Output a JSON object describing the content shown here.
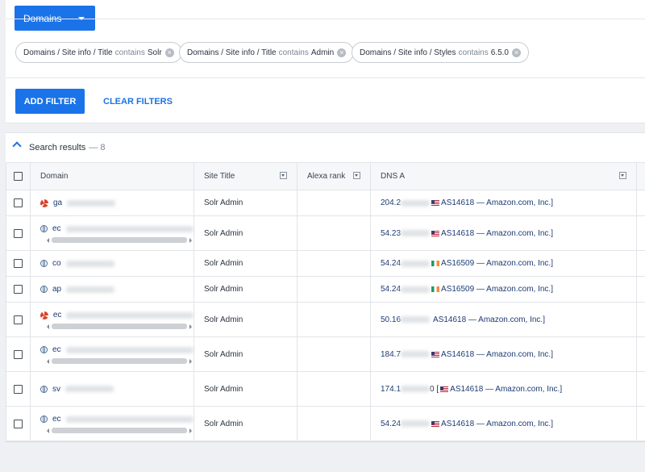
{
  "header": {
    "dropdown_label": "Domains"
  },
  "filters": [
    {
      "path": "Domains / Site info / Title",
      "op": "contains",
      "value": "Solr"
    },
    {
      "path": "Domains / Site info / Title",
      "op": "contains",
      "value": "Admin"
    },
    {
      "path": "Domains / Site info / Styles",
      "op": "contains",
      "value": "6.5.0"
    }
  ],
  "actions": {
    "add_filter": "ADD FILTER",
    "clear_filters": "CLEAR FILTERS"
  },
  "results": {
    "title": "Search results",
    "count": "— 8",
    "columns": [
      "Domain",
      "Site Title",
      "Alexa rank",
      "DNS A"
    ],
    "rows": [
      {
        "domain_prefix": "ga",
        "title": "Solr Admin",
        "alexa": "",
        "ip_prefix": "204.2",
        "asn": "AS14618 — Amazon.com, Inc.]",
        "flag": "us",
        "icon": "favicon-icon",
        "scroll": false
      },
      {
        "domain_prefix": "ec",
        "title": "Solr Admin",
        "alexa": "",
        "ip_prefix": "54.23",
        "asn": "AS14618 — Amazon.com, Inc.]",
        "flag": "us",
        "icon": "globe-icon",
        "scroll": true
      },
      {
        "domain_prefix": "co",
        "title": "Solr Admin",
        "alexa": "",
        "ip_prefix": "54.24",
        "asn": "AS16509 — Amazon.com, Inc.]",
        "flag": "ie",
        "icon": "globe-icon",
        "scroll": false
      },
      {
        "domain_prefix": "ap",
        "title": "Solr Admin",
        "alexa": "",
        "ip_prefix": "54.24",
        "asn": "AS16509 — Amazon.com, Inc.]",
        "flag": "ie",
        "icon": "globe-icon",
        "scroll": false
      },
      {
        "domain_prefix": "ec",
        "title": "Solr Admin",
        "alexa": "",
        "ip_prefix": "50.16",
        "asn": "AS14618 — Amazon.com, Inc.]",
        "flag": "none",
        "icon": "favicon-icon",
        "scroll": true
      },
      {
        "domain_prefix": "ec",
        "title": "Solr Admin",
        "alexa": "",
        "ip_prefix": "184.7",
        "asn": "AS14618 — Amazon.com, Inc.]",
        "flag": "us",
        "icon": "globe-icon",
        "scroll": true
      },
      {
        "domain_prefix": "sv",
        "title": "Solr Admin",
        "alexa": "",
        "ip_prefix": "174.1",
        "ip_suffix": "0 [",
        "asn": "AS14618 — Amazon.com, Inc.]",
        "flag": "us",
        "icon": "globe-icon",
        "scroll": false
      },
      {
        "domain_prefix": "ec",
        "title": "Solr Admin",
        "alexa": "",
        "ip_prefix": "54.24",
        "asn": "AS14618 — Amazon.com, Inc.]",
        "flag": "us",
        "icon": "globe-icon",
        "scroll": true
      }
    ]
  }
}
